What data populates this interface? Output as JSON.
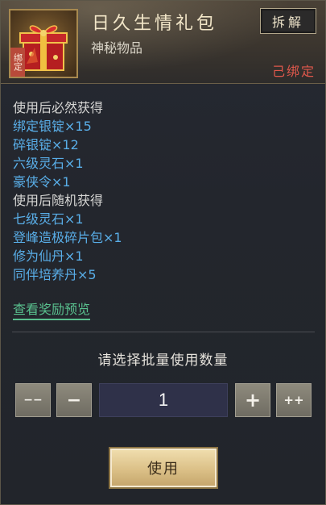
{
  "item": {
    "name": "日久生情礼包",
    "category": "神秘物品",
    "bind_tag": "绑定",
    "bound_status": "己绑定",
    "icon": "gift-box-icon"
  },
  "actions": {
    "split_label": "拆解",
    "use_label": "使用"
  },
  "contents": [
    {
      "text": "使用后必然获得",
      "type": "header"
    },
    {
      "text": "绑定银锭×15",
      "type": "item"
    },
    {
      "text": "碎银锭×12",
      "type": "item"
    },
    {
      "text": "六级灵石×1",
      "type": "item"
    },
    {
      "text": "豪侠令×1",
      "type": "item"
    },
    {
      "text": "使用后随机获得",
      "type": "header"
    },
    {
      "text": "七级灵石×1",
      "type": "item"
    },
    {
      "text": "登峰造极碎片包×1",
      "type": "item"
    },
    {
      "text": "修为仙丹×1",
      "type": "item"
    },
    {
      "text": "同伴培养丹×5",
      "type": "item"
    }
  ],
  "preview_link": "查看奖励预览",
  "batch": {
    "label": "请选择批量使用数量",
    "quantity": "1",
    "minus_many": "−−",
    "minus_one": "−",
    "plus_one": "+",
    "plus_many": "++"
  },
  "colors": {
    "header_text": "#d6d6d4",
    "item_text": "#59aee8",
    "link": "#59c08e",
    "bound": "#e0584c"
  }
}
